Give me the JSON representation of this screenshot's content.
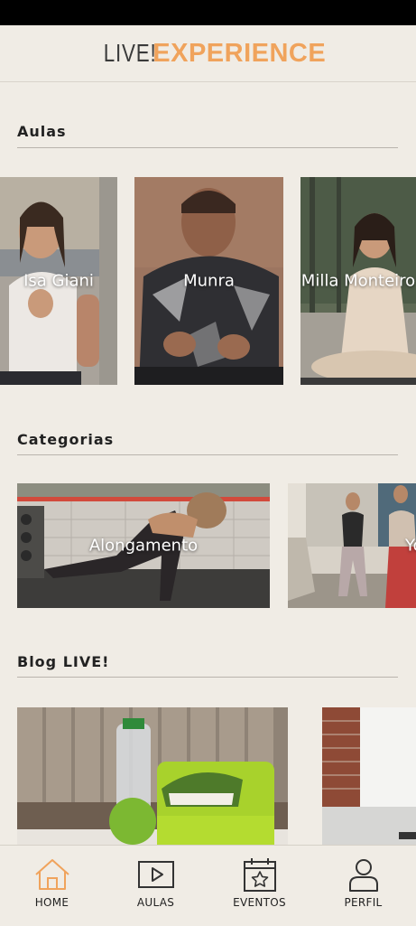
{
  "app": {
    "logo_left": "LIVE!",
    "logo_right": "EXPERIENCE"
  },
  "sections": {
    "aulas": {
      "title": "Aulas",
      "items": [
        {
          "label": "Isa Giani"
        },
        {
          "label": "Munra"
        },
        {
          "label": "Milla Monteiro"
        }
      ]
    },
    "categorias": {
      "title": "Categorias",
      "items": [
        {
          "label": "Alongamento"
        },
        {
          "label": "Yoga"
        }
      ]
    },
    "blog": {
      "title": "Blog LIVE!"
    }
  },
  "nav": {
    "items": [
      {
        "label": "HOME",
        "icon": "home-icon",
        "active": true
      },
      {
        "label": "AULAS",
        "icon": "video-play-icon",
        "active": false
      },
      {
        "label": "EVENTOS",
        "icon": "calendar-star-icon",
        "active": false
      },
      {
        "label": "PERFIL",
        "icon": "user-icon",
        "active": false
      }
    ]
  },
  "colors": {
    "background": "#f0ece5",
    "accent": "#f0a35c",
    "text": "#222222"
  }
}
